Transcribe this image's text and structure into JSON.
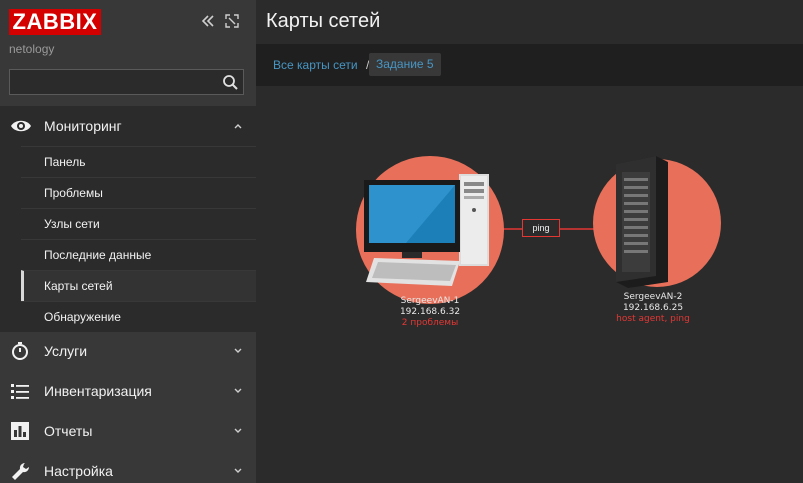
{
  "app": {
    "logo": "ZABBIX",
    "server_name": "netology"
  },
  "search": {
    "value": "",
    "placeholder": ""
  },
  "menu": {
    "monitoring": "Мониторинг",
    "services": "Услуги",
    "inventory": "Инвентаризация",
    "reports": "Отчеты",
    "configuration": "Настройка",
    "submenu": [
      "Панель",
      "Проблемы",
      "Узлы сети",
      "Последние данные",
      "Карты сетей",
      "Обнаружение"
    ]
  },
  "header": {
    "title": "Карты сетей"
  },
  "breadcrumb": {
    "all_maps": "Все карты сети",
    "separator": "/",
    "current": "Задание 5"
  },
  "map": {
    "link_label": "ping",
    "nodes": [
      {
        "name": "SergeevAN-1",
        "ip": "192.168.6.32",
        "status": "2 проблемы"
      },
      {
        "name": "SergeevAN-2",
        "ip": "192.168.6.25",
        "status": "host agent, ping"
      }
    ]
  },
  "colors": {
    "accent_red": "#d40000",
    "problem_red": "#e33734",
    "link_blue": "#4796c4",
    "node_circle": "#e8705a"
  }
}
